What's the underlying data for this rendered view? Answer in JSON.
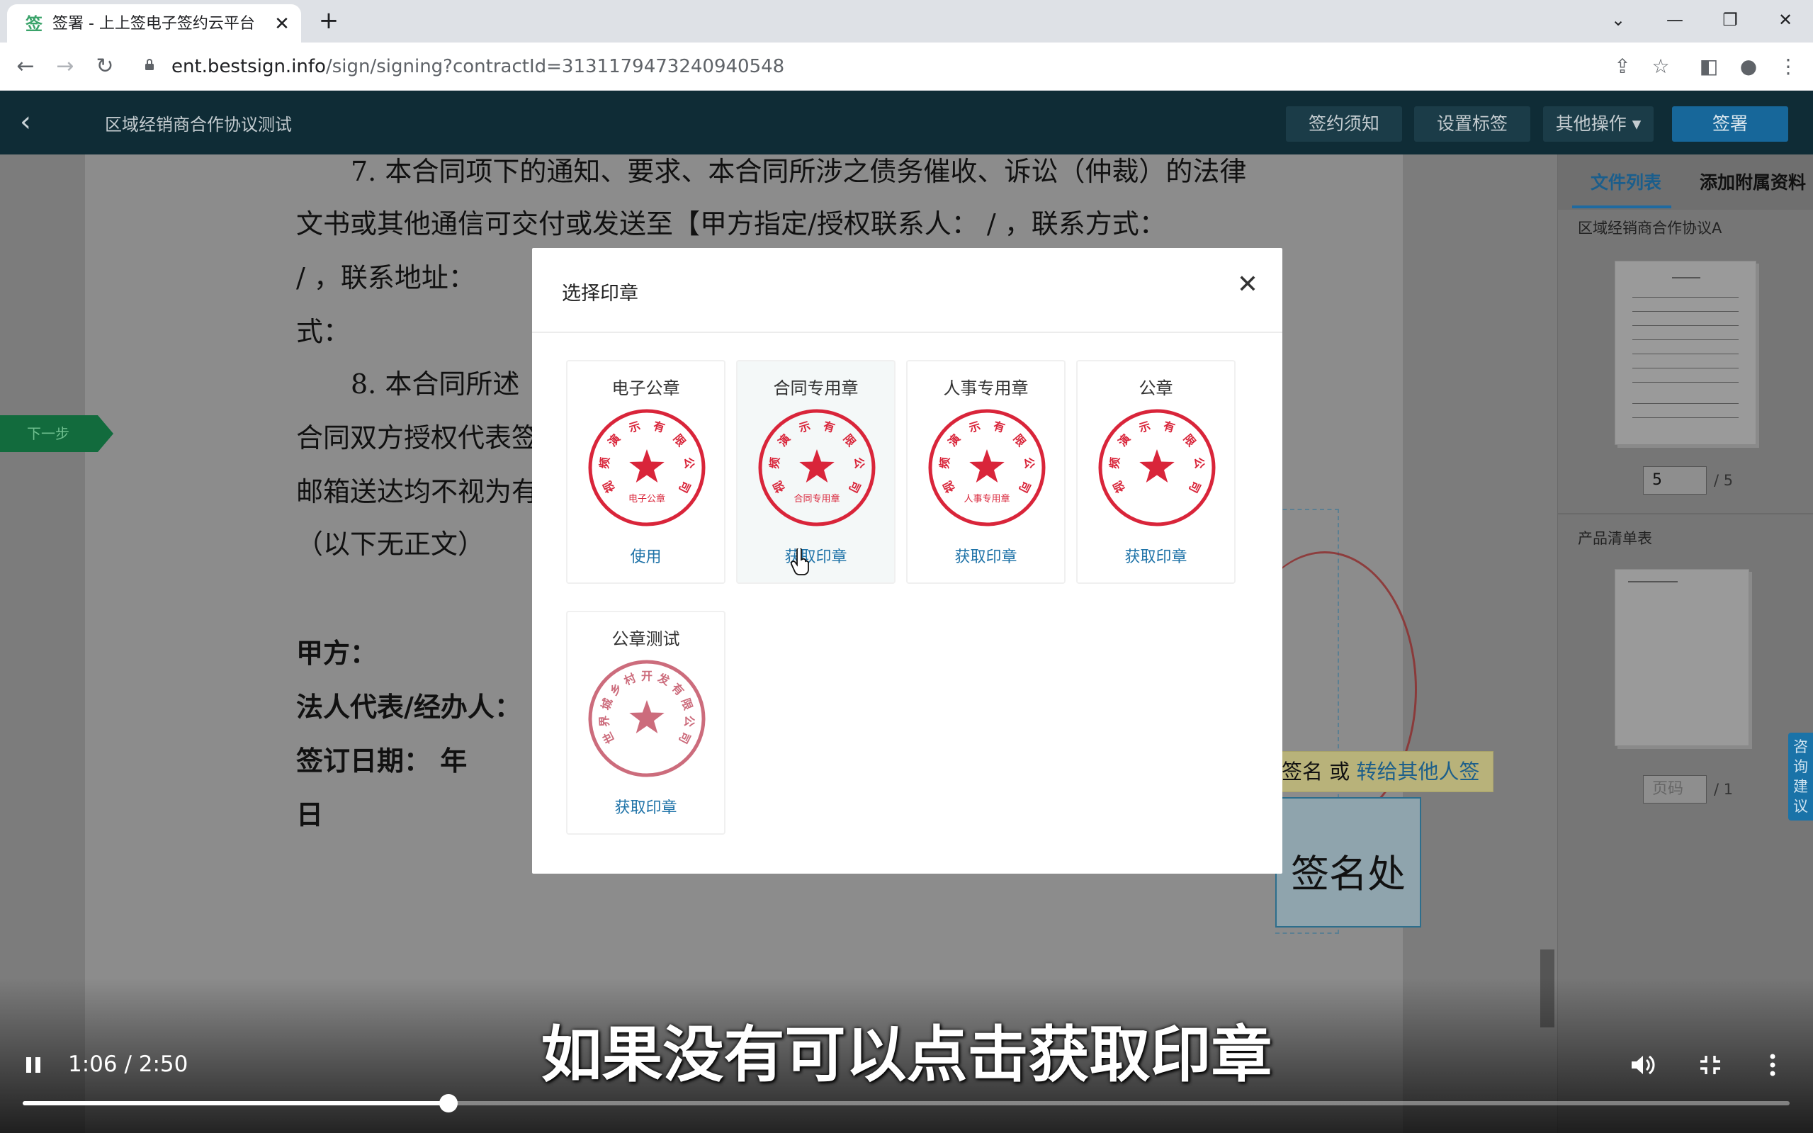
{
  "browser": {
    "tab_title": "签署 - 上上签电子签约云平台",
    "favicon": "签",
    "url_host": "ent.bestsign.info",
    "url_path": "/sign/signing?contractId=3131179473240940548"
  },
  "app": {
    "title": "区域经销商合作协议测试",
    "buttons": {
      "notice": "签约须知",
      "set_tag": "设置标签",
      "other_ops": "其他操作 ▾",
      "sign": "签署"
    },
    "next_step": "下一步"
  },
  "document": {
    "lines": [
      "7. 本合同项下的通知、要求、本合同所涉之债务催收、诉讼（仲裁）的法律",
      "文书或其他通信可交付或发送至【甲方指定/授权联系人：    /      ，联系方式：",
      "/        ，联系地址：",
      "式：",
      "8. 本合同所述",
      "合同双方授权代表签",
      "邮箱送达均不视为有",
      "（以下无正文）",
      "甲方：",
      "法人代表/经办人：",
      "签订日期：      年",
      "日"
    ],
    "sign_prompt_prefix": "签名 或 ",
    "sign_prompt_link": "转给其他人签",
    "sign_box_text": "签名处"
  },
  "right_panel": {
    "tabs": [
      "文件列表",
      "添加附属资料"
    ],
    "file1_name": "区域经销商合作协议A",
    "file1_page": "5",
    "file1_total": "/ 5",
    "file2_name": "产品清单表",
    "file2_page_placeholder": "页码",
    "file2_total": "/ 1",
    "consult": "咨询建议"
  },
  "modal": {
    "title": "选择印章",
    "seals": [
      {
        "name": "电子公章",
        "action": "使用",
        "inner": "电子公章",
        "ring": "视频演示有限公司"
      },
      {
        "name": "合同专用章",
        "action": "获取印章",
        "inner": "合同专用章",
        "ring": "视频演示有限公司"
      },
      {
        "name": "人事专用章",
        "action": "获取印章",
        "inner": "人事专用章",
        "ring": "视频演示有限公司"
      },
      {
        "name": "公章",
        "action": "获取印章",
        "inner": "",
        "ring": "视频演示有限公司"
      },
      {
        "name": "公章测试",
        "action": "获取印章",
        "inner": "",
        "ring": "世界城乡村开发有限公司"
      }
    ]
  },
  "video": {
    "subtitle": "如果没有可以点击获取印章",
    "time": "1:06 / 2:50",
    "progress": 0.241
  },
  "colors": {
    "seal_red": "#d9253a",
    "header_bg": "#0f2c36",
    "link_blue": "#1f73a8"
  }
}
